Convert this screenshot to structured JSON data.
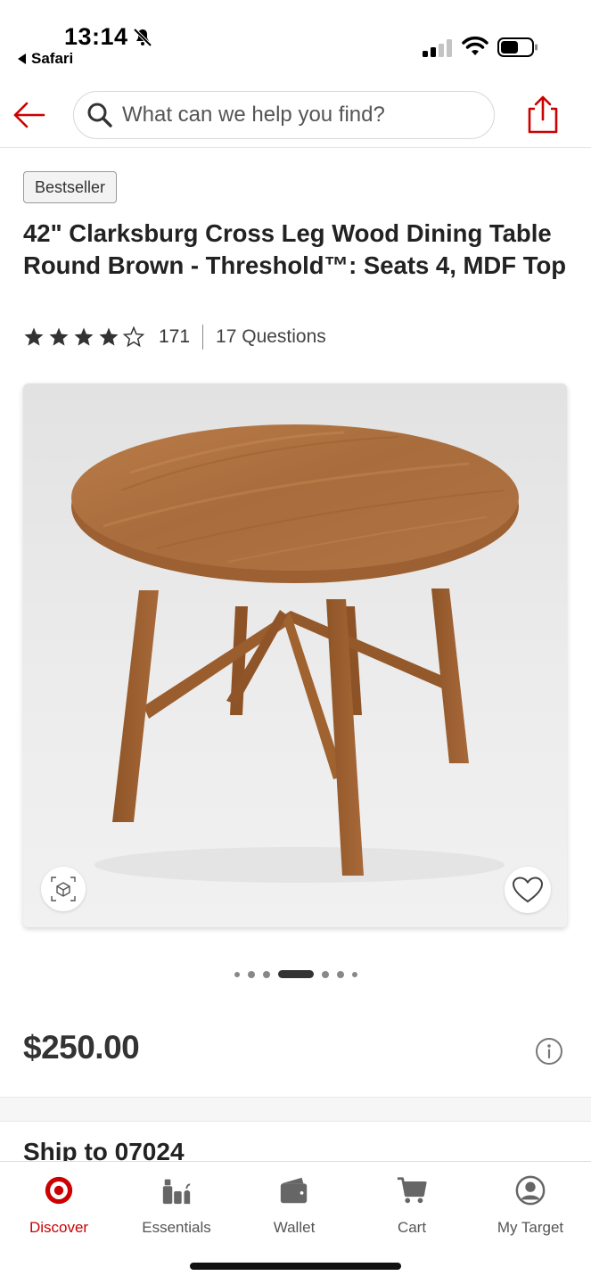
{
  "status_bar": {
    "time": "13:14",
    "back_app": "Safari"
  },
  "search": {
    "placeholder": "What can we help you find?"
  },
  "product": {
    "badge": "Bestseller",
    "title": "42\" Clarksburg Cross Leg Wood Dining Table Round Brown - Threshold™: Seats 4, MDF Top",
    "rating": 4,
    "rating_max": 5,
    "review_count": "171",
    "questions": "17 Questions",
    "price": "$250.00",
    "carousel": {
      "total": 7,
      "active_index": 3
    }
  },
  "shipping": {
    "ship_to": "Ship to 07024"
  },
  "bottom_nav": {
    "items": [
      {
        "label": "Discover",
        "icon": "target-bullseye-icon",
        "active": true
      },
      {
        "label": "Essentials",
        "icon": "essentials-icon",
        "active": false
      },
      {
        "label": "Wallet",
        "icon": "wallet-icon",
        "active": false
      },
      {
        "label": "Cart",
        "icon": "cart-icon",
        "active": false
      },
      {
        "label": "My Target",
        "icon": "account-icon",
        "active": false
      }
    ]
  },
  "colors": {
    "brand_red": "#cc0000",
    "text_dark": "#222222",
    "wood": "#a8693a"
  }
}
